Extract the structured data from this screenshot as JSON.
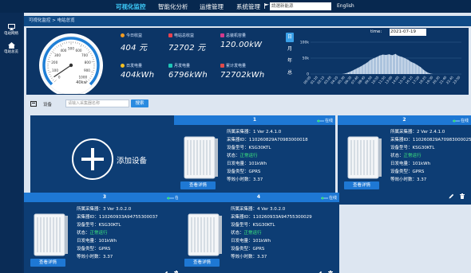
{
  "nav": {
    "items": [
      {
        "label": "可视化监控",
        "active": true
      },
      {
        "label": "智能化分析",
        "active": false
      },
      {
        "label": "运维管理",
        "active": false
      },
      {
        "label": "系统管理",
        "active": false
      }
    ],
    "plant_select_value": "請選新能源",
    "language": "English"
  },
  "sidebar": {
    "items": [
      {
        "label": "电站网络",
        "icon": "network-icon"
      },
      {
        "label": "电站总览",
        "icon": "home-icon"
      }
    ]
  },
  "breadcrumb": "可视化监控 > 电站总览",
  "gauge": {
    "value_label": "40kw",
    "ticks": [
      "0",
      "100",
      "200",
      "300",
      "400",
      "500",
      "600",
      "700",
      "800",
      "900",
      "1000"
    ],
    "needle_value": 40,
    "max": 1000
  },
  "stats": [
    {
      "label": "今日收益",
      "value": "404 元",
      "color": "#f39c22",
      "icon": "coin-icon"
    },
    {
      "label": "电站总收益",
      "value": "72702 元",
      "color": "#e8424e",
      "icon": "wallet-icon"
    },
    {
      "label": "总装机容量",
      "value": "120.00kW",
      "color": "#d23a8c",
      "icon": "capacity-icon"
    },
    {
      "label": "日发电量",
      "value": "404kWh",
      "color": "#f5c023",
      "icon": "sun-icon"
    },
    {
      "label": "月发电量",
      "value": "6796kWh",
      "color": "#1ec6b6",
      "icon": "calendar-icon"
    },
    {
      "label": "累计发电量",
      "value": "72702kWh",
      "color": "#e04a4a",
      "icon": "total-icon"
    }
  ],
  "period_tabs": [
    {
      "label": "日",
      "active": true
    },
    {
      "label": "月",
      "active": false
    },
    {
      "label": "年",
      "active": false
    },
    {
      "label": "总",
      "active": false
    }
  ],
  "chart_time": {
    "label": "time:",
    "value": "2021-07-19"
  },
  "chart_data": {
    "type": "area",
    "y_ticks": [
      "0",
      "50k",
      "100k"
    ],
    "ylim": [
      0,
      100000
    ],
    "x_ticks": [
      "00:05",
      "01:10",
      "02:15",
      "03:20",
      "04:25",
      "05:30",
      "06:35",
      "07:40",
      "08:45",
      "09:50",
      "10:55",
      "11:55",
      "13:00",
      "14:05",
      "15:10",
      "16:15",
      "17:20",
      "18:25",
      "19:30",
      "20:35",
      "21:40",
      "22:45",
      "23:50"
    ],
    "x_start_hour": 0.083,
    "x_end_hour": 23.833,
    "x": [
      0,
      1,
      2,
      3,
      4,
      5,
      5.5,
      6,
      6.5,
      7,
      7.5,
      8,
      8.5,
      9,
      9.5,
      10,
      10.5,
      11,
      11.5,
      12,
      12.5,
      13,
      13.5,
      14,
      14.5,
      15,
      15.5,
      16,
      16.5,
      17,
      17.5,
      18,
      18.5,
      19,
      19.5,
      20,
      21,
      22,
      23,
      23.83
    ],
    "values": [
      0,
      0,
      0,
      0,
      0,
      0,
      1500,
      5000,
      9000,
      14000,
      19000,
      24000,
      30000,
      36000,
      44000,
      49000,
      53000,
      58000,
      61000,
      60000,
      62000,
      59000,
      63000,
      57000,
      54000,
      50000,
      45000,
      38000,
      34000,
      28000,
      22000,
      13000,
      6000,
      2000,
      0,
      0,
      0,
      0,
      0,
      0
    ]
  },
  "search": {
    "label": "设备",
    "placeholder": "请输入采集器名称",
    "button": "搜索"
  },
  "add_card": {
    "label": "添加设备"
  },
  "devices": [
    {
      "title": "1",
      "online": "在线",
      "collector": "所属采集器：1  Ver 2.4.1.0",
      "collector_id": "采集器ID：110260829A70983000018",
      "model": "设备型号：KSG30KTL",
      "status_label": "状态：",
      "status_value": "正常运行",
      "daily": "日发电量：101kWh",
      "type": "设备类型：GPRS",
      "hours": "等效小时数：3.37",
      "detail": "查看详情"
    },
    {
      "title": "2",
      "online": "在线",
      "collector": "所属采集器：2  Ver 2.4.1.0",
      "collector_id": "采集器ID：110260829A70983000025",
      "model": "设备型号：KSG30KTL",
      "status_label": "状态：",
      "status_value": "正常运行",
      "daily": "日发电量：101kWh",
      "type": "设备类型：GPRS",
      "hours": "等效小时数：3.37",
      "detail": "查看详情"
    },
    {
      "title": "3",
      "online": "在线",
      "collector": "所属采集器：3  Ver 3.0.2.0",
      "collector_id": "采集器ID：110260933A94755300037",
      "model": "设备型号：KSG30KTL",
      "status_label": "状态：",
      "status_value": "正常运行",
      "daily": "日发电量：101kWh",
      "type": "设备类型：GPRS",
      "hours": "等效小时数：3.37",
      "detail": "查看详情"
    },
    {
      "title": "4",
      "online": "在线",
      "collector": "所属采集器：4  Ver 3.0.2.0",
      "collector_id": "采集器ID：110260933A94755300029",
      "model": "设备型号：KSG30KTL",
      "status_label": "状态：",
      "status_value": "正常运行",
      "daily": "日发电量：101kWh",
      "type": "设备类型：GPRS",
      "hours": "等效小时数：3.37",
      "detail": "查看详情"
    }
  ]
}
